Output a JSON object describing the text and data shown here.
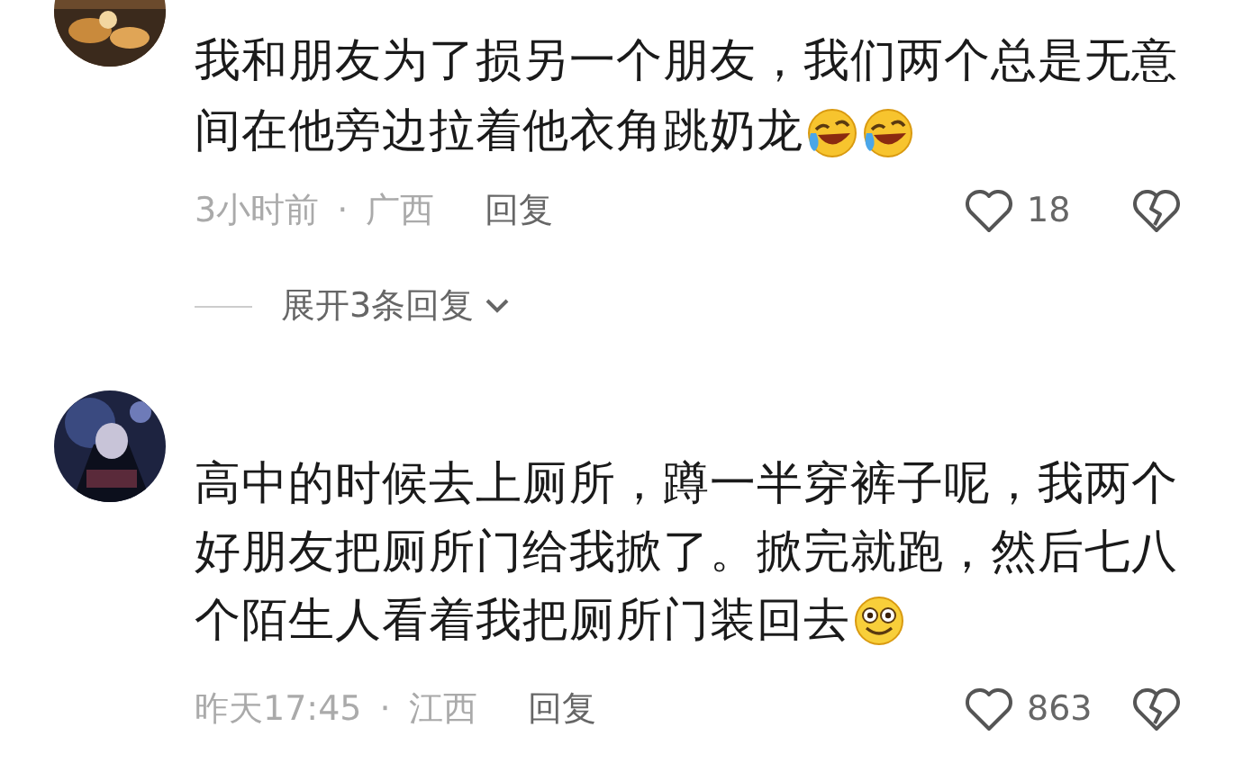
{
  "comments": [
    {
      "avatar": {
        "kind": "picture"
      },
      "lines": [
        "我和朋友为了损另一个朋友，我们两个总是无意",
        "间在他旁边拉着他衣角跳奶龙"
      ],
      "emojis": [
        {
          "kind": "laughing-tears"
        },
        {
          "kind": "laughing-tears"
        }
      ],
      "time": "3小时前",
      "separator": "·",
      "location": "广西",
      "reply": "回复",
      "likes": "18",
      "expand": "展开3条回复"
    },
    {
      "avatar": {
        "kind": "picture"
      },
      "lines": [
        "高中的时候去上厕所，蹲一半穿裤子呢，我两个",
        "好朋友把厕所门给我掀了。掀完就跑，然后七八",
        "个陌生人看着我把厕所门装回去"
      ],
      "emojis": [
        {
          "kind": "smile"
        }
      ],
      "time": "昨天17:45",
      "separator": "·",
      "location": "江西",
      "reply": "回复",
      "likes": "863"
    }
  ]
}
